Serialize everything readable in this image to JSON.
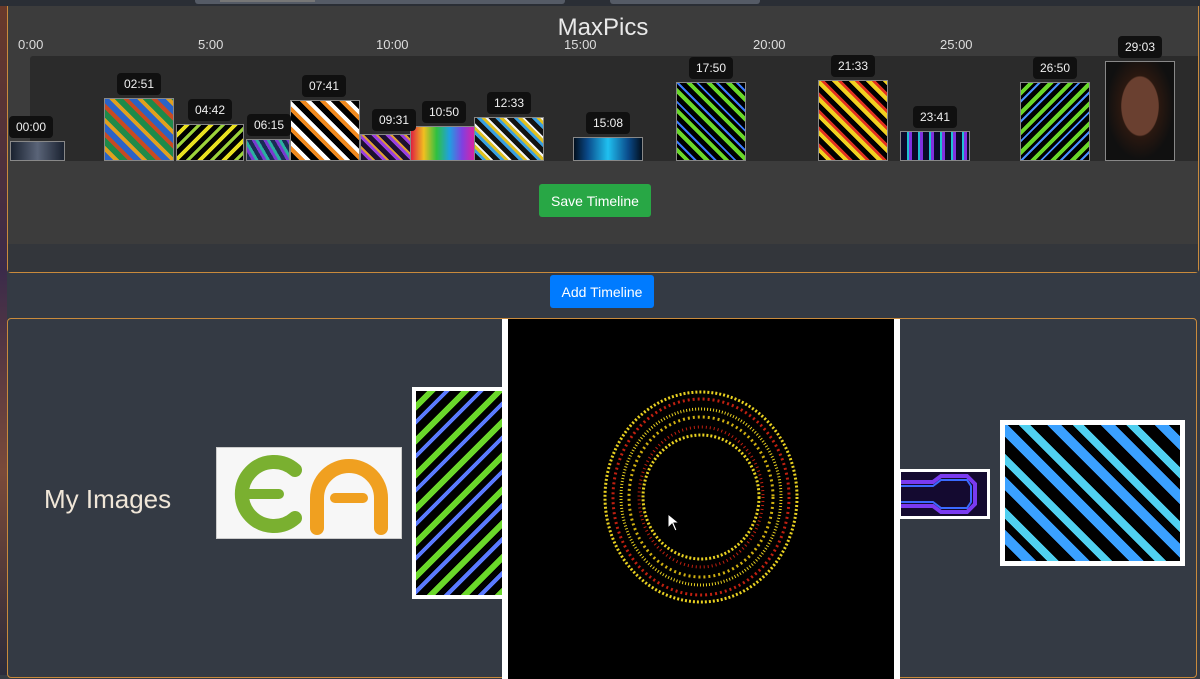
{
  "app": {
    "title": "MaxPics"
  },
  "ruler": {
    "labels": [
      "0:00",
      "5:00",
      "10:00",
      "15:00",
      "20:00",
      "25:00"
    ]
  },
  "timeline": {
    "items": [
      {
        "time": "00:00",
        "name": "avengers-logo-thumb"
      },
      {
        "time": "02:51",
        "name": "weave-pattern-thumb"
      },
      {
        "time": "04:42",
        "name": "chevron-pattern-thumb"
      },
      {
        "time": "06:15",
        "name": "cube-pattern-thumb"
      },
      {
        "time": "07:41",
        "name": "orange-x-pattern-thumb"
      },
      {
        "time": "09:31",
        "name": "purple-pattern-thumb"
      },
      {
        "time": "10:50",
        "name": "rainbow-wave-thumb"
      },
      {
        "time": "12:33",
        "name": "diamond-pattern-thumb"
      },
      {
        "time": "15:08",
        "name": "blue-line-thumb"
      },
      {
        "time": "17:50",
        "name": "green-chevron-thumb"
      },
      {
        "time": "21:33",
        "name": "red-yellow-diamond-thumb"
      },
      {
        "time": "23:41",
        "name": "teal-purple-thumb"
      },
      {
        "time": "26:50",
        "name": "green-chevron-thumb-2"
      },
      {
        "time": "29:03",
        "name": "eyepatch-portrait-thumb"
      }
    ],
    "save_label": "Save Timeline"
  },
  "add_timeline_label": "Add Timeline",
  "gallery": {
    "title": "My Images"
  },
  "colors": {
    "save": "#28a745",
    "add": "#007bff",
    "border_accent": "#c98a3c",
    "panel_bg": "#3c3c3c",
    "page_bg": "#343a44"
  }
}
